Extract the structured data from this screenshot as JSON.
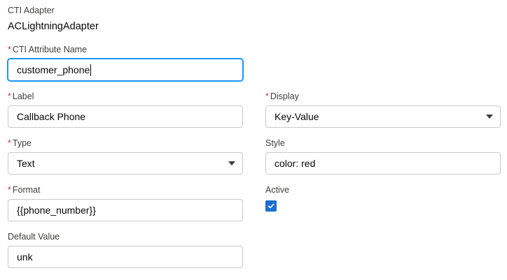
{
  "cti_adapter": {
    "label": "CTI Adapter",
    "value": "ACLightningAdapter"
  },
  "required_marker": "*",
  "cti_attribute_name": {
    "label": "CTI Attribute Name",
    "value": "customer_phone"
  },
  "label_field": {
    "label": "Label",
    "value": "Callback Phone"
  },
  "display": {
    "label": "Display",
    "value": "Key-Value"
  },
  "type": {
    "label": "Type",
    "value": "Text"
  },
  "style": {
    "label": "Style",
    "value": "color: red"
  },
  "format": {
    "label": "Format",
    "value": "{{phone_number}}"
  },
  "active": {
    "label": "Active",
    "checked": true
  },
  "default_value": {
    "label": "Default Value",
    "value": "unk"
  },
  "colors": {
    "required": "#c23934",
    "focus": "#1b96ff",
    "checkbox": "#1b6fd1"
  }
}
